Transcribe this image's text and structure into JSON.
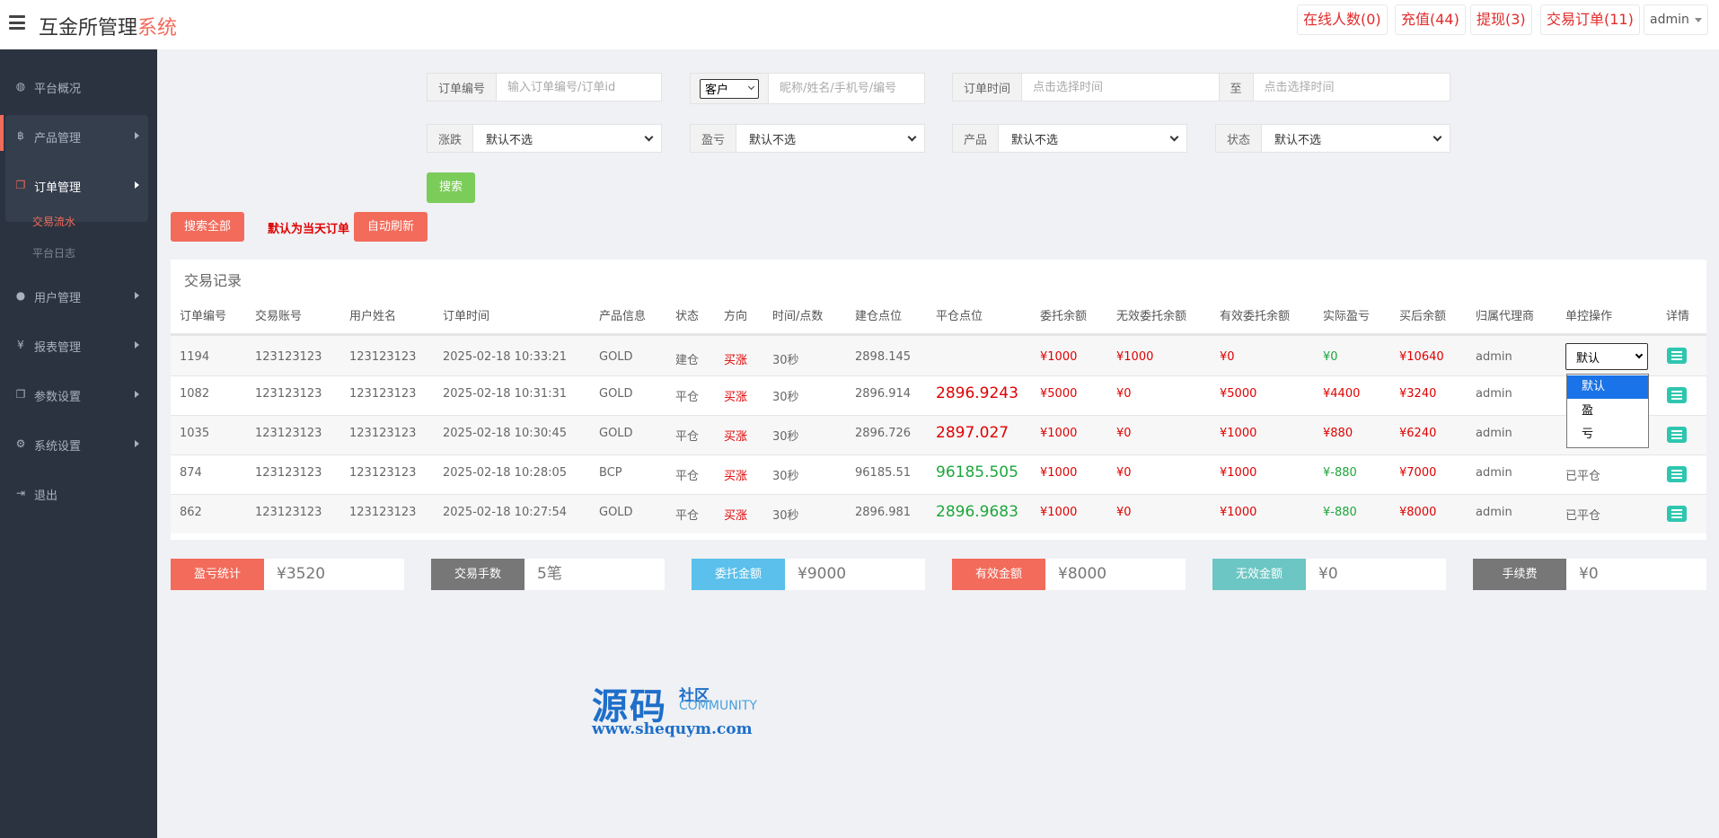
{
  "header": {
    "brand_main": "互金所管理",
    "brand_accent": "系统",
    "online": "在线人数(0)",
    "recharge": "充值(44)",
    "withdraw": "提现(3)",
    "trade_orders": "交易订单(11)",
    "user": "admin"
  },
  "sidebar": {
    "items": [
      {
        "label": "平台概况",
        "icon": "dashboard-icon"
      },
      {
        "label": "产品管理",
        "icon": "bitcoin-icon"
      },
      {
        "label": "订单管理",
        "icon": "copy-icon"
      },
      {
        "label": "用户管理",
        "icon": "user-icon"
      },
      {
        "label": "报表管理",
        "icon": "yen-icon"
      },
      {
        "label": "参数设置",
        "icon": "copy-icon"
      },
      {
        "label": "系统设置",
        "icon": "gears-icon"
      },
      {
        "label": "退出",
        "icon": "sign-out-icon"
      }
    ],
    "sub": [
      "交易流水",
      "平台日志"
    ]
  },
  "filters": {
    "order_no_label": "订单编号",
    "order_no_placeholder": "输入订单编号/订单id",
    "customer_select": "客户",
    "customer_placeholder": "昵称/姓名/手机号/编号",
    "time_label": "订单时间",
    "time_placeholder": "点击选择时间",
    "to_label": "至",
    "time_end_placeholder": "点击选择时间",
    "rise_label": "涨跌",
    "pl_label": "盈亏",
    "product_label": "产品",
    "status_label": "状态",
    "default_option": "默认不选",
    "search": "搜索",
    "search_all": "搜索全部",
    "today_note": "默认为当天订单",
    "auto_refresh": "自动刷新"
  },
  "table": {
    "title": "交易记录",
    "headers": [
      "订单编号",
      "交易账号",
      "用户姓名",
      "订单时间",
      "产品信息",
      "状态",
      "方向",
      "时间/点数",
      "建仓点位",
      "平仓点位",
      "委托余额",
      "无效委托余额",
      "有效委托余额",
      "实际盈亏",
      "买后余额",
      "归属代理商",
      "单控操作",
      "详情"
    ],
    "rows": [
      {
        "id": "1194",
        "account": "123123123",
        "name": "123123123",
        "time": "2025-02-18 10:33:21",
        "product": "GOLD",
        "status": "建仓",
        "dir": "买涨",
        "dur": "30秒",
        "open": "2898.145",
        "close": "",
        "entrust": "¥1000",
        "invalid": "¥1000",
        "valid": "¥0",
        "pl": "¥0",
        "after": "¥10640",
        "agent": "admin",
        "op": "默认"
      },
      {
        "id": "1082",
        "account": "123123123",
        "name": "123123123",
        "time": "2025-02-18 10:31:31",
        "product": "GOLD",
        "status": "平仓",
        "dir": "买涨",
        "dur": "30秒",
        "open": "2896.914",
        "close": "2896.9243",
        "entrust": "¥5000",
        "invalid": "¥0",
        "valid": "¥5000",
        "pl": "¥4400",
        "after": "¥3240",
        "agent": "admin",
        "op": ""
      },
      {
        "id": "1035",
        "account": "123123123",
        "name": "123123123",
        "time": "2025-02-18 10:30:45",
        "product": "GOLD",
        "status": "平仓",
        "dir": "买涨",
        "dur": "30秒",
        "open": "2896.726",
        "close": "2897.027",
        "entrust": "¥1000",
        "invalid": "¥0",
        "valid": "¥1000",
        "pl": "¥880",
        "after": "¥6240",
        "agent": "admin",
        "op": ""
      },
      {
        "id": "874",
        "account": "123123123",
        "name": "123123123",
        "time": "2025-02-18 10:28:05",
        "product": "BCP",
        "status": "平仓",
        "dir": "买涨",
        "dur": "30秒",
        "open": "96185.51",
        "close": "96185.505",
        "entrust": "¥1000",
        "invalid": "¥0",
        "valid": "¥1000",
        "pl": "¥-880",
        "after": "¥7000",
        "agent": "admin",
        "op": "已平仓"
      },
      {
        "id": "862",
        "account": "123123123",
        "name": "123123123",
        "time": "2025-02-18 10:27:54",
        "product": "GOLD",
        "status": "平仓",
        "dir": "买涨",
        "dur": "30秒",
        "open": "2896.981",
        "close": "2896.9683",
        "entrust": "¥1000",
        "invalid": "¥0",
        "valid": "¥1000",
        "pl": "¥-880",
        "after": "¥8000",
        "agent": "admin",
        "op": "已平仓"
      }
    ],
    "dropdown": [
      "默认",
      "盈",
      "亏"
    ]
  },
  "stats": [
    {
      "label": "盈亏统计",
      "value": "¥3520",
      "color": "#f26b5b"
    },
    {
      "label": "交易手数",
      "value": "5笔",
      "color": "#777777"
    },
    {
      "label": "委托金额",
      "value": "¥9000",
      "color": "#5bc0eb"
    },
    {
      "label": "有效金额",
      "value": "¥8000",
      "color": "#f26b5b"
    },
    {
      "label": "无效金额",
      "value": "¥0",
      "color": "#6cc6c3"
    },
    {
      "label": "手续费",
      "value": "¥0",
      "color": "#777777"
    }
  ],
  "watermark": {
    "main": "源码",
    "sub1": "社区",
    "sub2": "COMMUNITY",
    "url": "www.shequym.com"
  }
}
